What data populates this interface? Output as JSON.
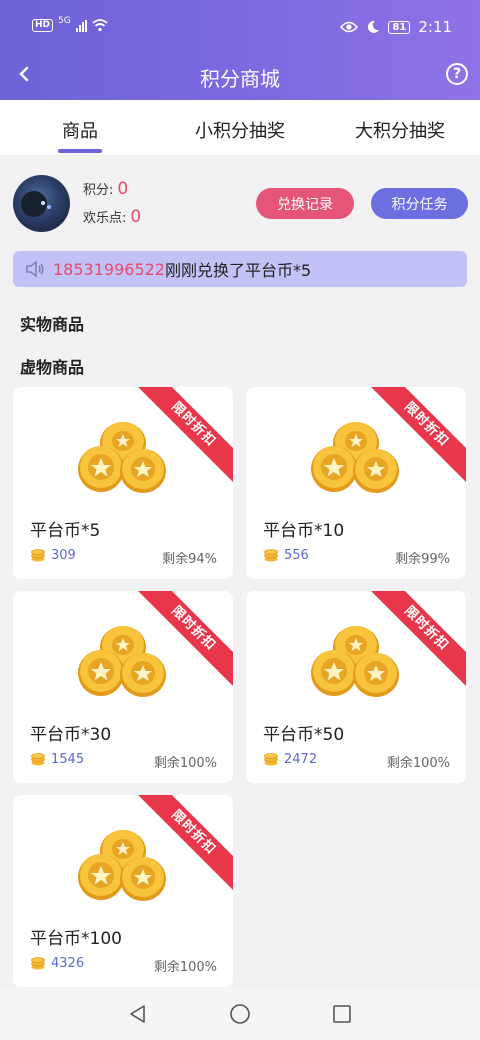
{
  "status_bar": {
    "network_badge": "HD",
    "network_type": "5G",
    "battery_text": "81",
    "time": "2:11",
    "icons": [
      "signal-icon",
      "wifi-icon",
      "eye-icon",
      "moon-icon",
      "battery-icon"
    ]
  },
  "header": {
    "title": "积分商城",
    "back_icon": "back-arrow-icon",
    "help_icon": "help-circle-icon",
    "help_glyph": "?"
  },
  "tabs": [
    {
      "label": "商品",
      "active": true
    },
    {
      "label": "小积分抽奖",
      "active": false
    },
    {
      "label": "大积分抽奖",
      "active": false
    }
  ],
  "profile": {
    "points_label": "积分:",
    "points_value": "0",
    "joy_label": "欢乐点:",
    "joy_value": "0",
    "exchange_button": "兑换记录",
    "task_button": "积分任务"
  },
  "notice": {
    "icon": "speaker-icon",
    "number": "18531996522",
    "text": "刚刚兑换了平台币*5"
  },
  "sections": {
    "physical": "实物商品",
    "virtual": "虚物商品"
  },
  "products": [
    {
      "name": "平台币*5",
      "price": "309",
      "remaining": "剩余94%",
      "badge": "限时折扣"
    },
    {
      "name": "平台币*10",
      "price": "556",
      "remaining": "剩余99%",
      "badge": "限时折扣"
    },
    {
      "name": "平台币*30",
      "price": "1545",
      "remaining": "剩余100%",
      "badge": "限时折扣"
    },
    {
      "name": "平台币*50",
      "price": "2472",
      "remaining": "剩余100%",
      "badge": "限时折扣"
    },
    {
      "name": "平台币*100",
      "price": "4326",
      "remaining": "剩余100%",
      "badge": "限时折扣"
    }
  ],
  "colors": {
    "accent": "#6c63d9",
    "pink": "#e55577",
    "value_red": "#e84a6a",
    "ribbon_red": "#e8374a",
    "price_blue": "#5d6ad6",
    "notice_bg": "#c3c2f6",
    "coin_gold": "#f5b731"
  },
  "nav": [
    "nav-back-icon",
    "nav-home-icon",
    "nav-recent-icon"
  ]
}
